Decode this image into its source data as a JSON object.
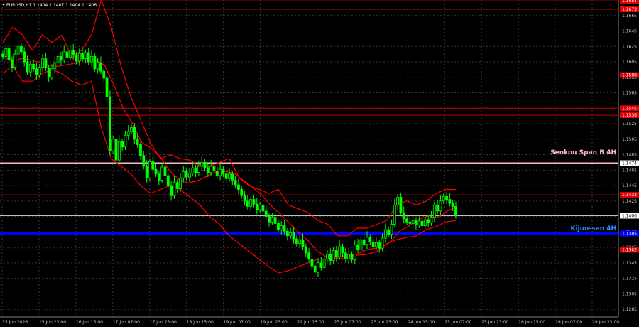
{
  "header": {
    "symbol_text": "EURUSD,H1  1.1404 1.1407 1.1404 1.1406"
  },
  "colors": {
    "background": "#000000",
    "grid": "#3a3a3a",
    "candle_up": "#00ff00",
    "candle_down": "#00ff00",
    "ichimoku": "#ff0000",
    "level": "#c00000",
    "senkou": "#ffb6c1",
    "kijun": "#0000ff",
    "current": "#ffffff",
    "text": "#c8c8c8",
    "kijun_text": "#1e90ff"
  },
  "chart_data": {
    "type": "candlestick",
    "symbol": "EURUSD",
    "timeframe": "H1",
    "ylim": [
      1.1275,
      1.1685
    ],
    "y_ticks": [
      "1.1665",
      "1.1645",
      "1.1625",
      "1.1605",
      "1.1585",
      "1.1565",
      "1.1545",
      "1.1525",
      "1.1505",
      "1.1485",
      "1.1465",
      "1.1445",
      "1.1425",
      "1.1405",
      "1.1385",
      "1.1365",
      "1.1345",
      "1.1325",
      "1.1305",
      "1.1285"
    ],
    "x_ticks": [
      "15 Jun 2026",
      "15 Jun 23:00",
      "16 Jun 15:00",
      "17 Jun 07:00",
      "17 Jun 23:00",
      "18 Jun 15:00",
      "19 Jun 07:00",
      "19 Jun 23:00",
      "22 Jun 15:00",
      "23 Jun 07:00",
      "23 Jun 23:00",
      "24 Jun 15:00",
      "25 Jun 07:00",
      "25 Jun 23:00",
      "26 Jun 15:00",
      "29 Jun 07:00",
      "29 Jun 23:00"
    ],
    "levels": [
      {
        "price": 1.1684,
        "label": "1.1684",
        "kind": "level"
      },
      {
        "price": 1.1673,
        "label": "1.1673",
        "kind": "level"
      },
      {
        "price": 1.1588,
        "label": "1.1588",
        "kind": "level"
      },
      {
        "price": 1.1545,
        "label": "1.1545",
        "kind": "level"
      },
      {
        "price": 1.1536,
        "label": "1.1536",
        "kind": "level"
      },
      {
        "price": 1.1474,
        "label": "1.1474",
        "kind": "senkou"
      },
      {
        "price": 1.1433,
        "label": "1.1433",
        "kind": "level"
      },
      {
        "price": 1.1406,
        "label": "1.1406",
        "kind": "current"
      },
      {
        "price": 1.1383,
        "label": "1.1385",
        "kind": "kijun"
      },
      {
        "price": 1.1362,
        "label": "1.1362",
        "kind": "level"
      }
    ],
    "annotations": {
      "senkou": "Senkou Span B 4H",
      "kijun": "Kijun-sen 4H"
    },
    "closes_start": 1.1615,
    "closes": [
      1.1612,
      1.1622,
      1.1608,
      1.1598,
      1.1615,
      1.1625,
      1.1618,
      1.1605,
      1.1592,
      1.1602,
      1.1596,
      1.1588,
      1.1598,
      1.1609,
      1.1597,
      1.1585,
      1.1596,
      1.1604,
      1.1612,
      1.1607,
      1.1618,
      1.1611,
      1.162,
      1.1614,
      1.1606,
      1.1616,
      1.1609,
      1.1617,
      1.1605,
      1.1612,
      1.1596,
      1.1604,
      1.1593,
      1.1584,
      1.156,
      1.149,
      1.1505,
      1.1478,
      1.1502,
      1.1495,
      1.151,
      1.1515,
      1.152,
      1.1505,
      1.1498,
      1.1484,
      1.147,
      1.1455,
      1.1476,
      1.1466,
      1.146,
      1.1452,
      1.1469,
      1.1458,
      1.1445,
      1.1432,
      1.1449,
      1.1441,
      1.1455,
      1.1463,
      1.1456,
      1.1461,
      1.1468,
      1.1462,
      1.147,
      1.1475,
      1.1468,
      1.1462,
      1.147,
      1.1464,
      1.1458,
      1.1466,
      1.146,
      1.1454,
      1.146,
      1.1452,
      1.1446,
      1.144,
      1.1432,
      1.1425,
      1.1418,
      1.1427,
      1.1421,
      1.1414,
      1.142,
      1.1412,
      1.1405,
      1.1398,
      1.1404,
      1.1396,
      1.1388,
      1.1393,
      1.1386,
      1.138,
      1.1384,
      1.1376,
      1.137,
      1.1375,
      1.1366,
      1.1358,
      1.135,
      1.1341,
      1.1333,
      1.1345,
      1.1339,
      1.135,
      1.1356,
      1.1348,
      1.1361,
      1.1353,
      1.1366,
      1.1358,
      1.135,
      1.1356,
      1.1349,
      1.1368,
      1.1362,
      1.1375,
      1.1369,
      1.1378,
      1.1372,
      1.1366,
      1.1371,
      1.1364,
      1.1377,
      1.1388,
      1.1382,
      1.1395,
      1.142,
      1.143,
      1.141,
      1.1402,
      1.1398,
      1.1396,
      1.14,
      1.1394,
      1.1399,
      1.1393,
      1.1401,
      1.1397,
      1.1404,
      1.142,
      1.1412,
      1.1425,
      1.1431,
      1.1427,
      1.1422,
      1.1418,
      1.1406
    ],
    "ichimoku_band": {
      "upper": [
        1.163,
        1.165,
        1.164,
        1.162,
        1.164,
        1.163,
        1.164,
        1.161,
        1.162,
        1.164,
        1.1685,
        1.165,
        1.16,
        1.156,
        1.153,
        1.15,
        1.148,
        1.1485,
        1.148,
        1.1478,
        1.147,
        1.147,
        1.1475,
        1.148,
        1.1455,
        1.1445,
        1.144,
        1.1435,
        1.144,
        1.142,
        1.1415,
        1.141,
        1.14,
        1.1395,
        1.138,
        1.138,
        1.139,
        1.139,
        1.1395,
        1.14,
        1.142,
        1.1425,
        1.142,
        1.1425,
        1.1435,
        1.144,
        1.144
      ],
      "lower": [
        1.159,
        1.16,
        1.158,
        1.158,
        1.159,
        1.1595,
        1.159,
        1.158,
        1.1575,
        1.158,
        1.152,
        1.148,
        1.147,
        1.146,
        1.1445,
        1.1435,
        1.144,
        1.1445,
        1.144,
        1.143,
        1.142,
        1.1405,
        1.1395,
        1.138,
        1.137,
        1.136,
        1.135,
        1.134,
        1.1332,
        1.1335,
        1.134,
        1.1345,
        1.135,
        1.135,
        1.1352,
        1.1355,
        1.1355,
        1.1356,
        1.136,
        1.137,
        1.1375,
        1.1378,
        1.138,
        1.1388,
        1.1392,
        1.1398,
        1.14
      ]
    }
  }
}
